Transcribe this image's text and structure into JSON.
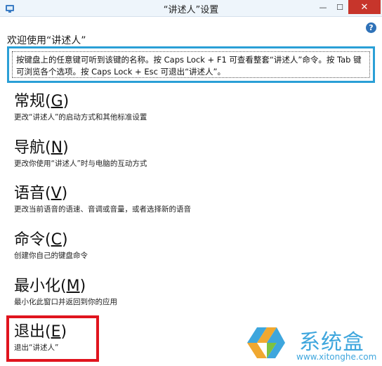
{
  "window": {
    "title": "“讲述人”设置",
    "minimize_glyph": "—",
    "maximize_glyph": "☐",
    "close_glyph": "✕"
  },
  "help": {
    "glyph": "?"
  },
  "welcome_text": "欢迎使用“讲述人”",
  "info_text": "按键盘上的任意键可听到该键的名称。按 Caps Lock + F1 可查看整套“讲述人”命令。按 Tab 键可浏览各个选项。按 Caps Lock + Esc 可退出“讲述人”。",
  "menu": {
    "general": {
      "title": "常规(",
      "key": "G",
      "close": ")",
      "desc": "更改“讲述人”的启动方式和其他标准设置"
    },
    "navigation": {
      "title": "导航(",
      "key": "N",
      "close": ")",
      "desc": "更改你使用“讲述人”时与电脑的互动方式"
    },
    "voice": {
      "title": "语音(",
      "key": "V",
      "close": ")",
      "desc": "更改当前语音的语速、音调或音量，或者选择新的语音"
    },
    "commands": {
      "title": "命令(",
      "key": "C",
      "close": ")",
      "desc": "创建你自己的键盘命令"
    },
    "minimize": {
      "title": "最小化(",
      "key": "M",
      "close": ")",
      "desc": "最小化此窗口并返回到你的应用"
    },
    "exit": {
      "title": "退出(",
      "key": "E",
      "close": ")",
      "desc": "退出“讲述人”"
    }
  },
  "watermark": {
    "brand": "系统盒",
    "url": "www.xitonghe.com"
  },
  "colors": {
    "info_border": "#2a9fd6",
    "exit_highlight": "#e0141e",
    "watermark": "#3ea6dd",
    "close_button": "#c7352b"
  },
  "icons": {
    "app": "narrator-app-icon",
    "help": "help-icon",
    "watermark_logo": "xitonghe-logo-icon"
  }
}
